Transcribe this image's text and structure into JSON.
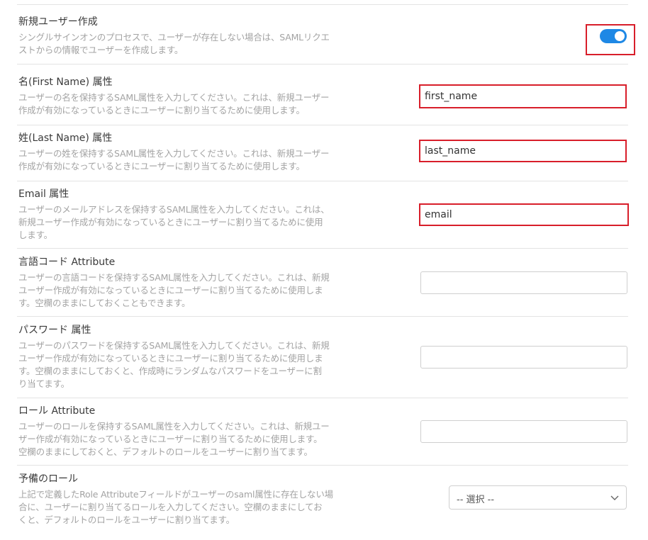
{
  "sections": {
    "create_user": {
      "label": "新規ユーザー作成",
      "desc": [
        "シングルサインオンのプロセスで、ユーザーが存在しない場合は、SAMLリクエ",
        "ストからの情報でユーザーを作成します。"
      ],
      "toggle_on": true
    },
    "first_name": {
      "label": "名(First Name) 属性",
      "desc": [
        "ユーザーの名を保持するSAML属性を入力してください。これは、新規ユーザー",
        "作成が有効になっているときにユーザーに割り当てるために使用します。"
      ],
      "value": "first_name"
    },
    "last_name": {
      "label": "姓(Last Name) 属性",
      "desc": [
        "ユーザーの姓を保持するSAML属性を入力してください。これは、新規ユーザー",
        "作成が有効になっているときにユーザーに割り当てるために使用します。"
      ],
      "value": "last_name"
    },
    "email": {
      "label": "Email 属性",
      "desc": [
        "ユーザーのメールアドレスを保持するSAML属性を入力してください。これは、",
        "新規ユーザー作成が有効になっているときにユーザーに割り当てるために使用",
        "します。"
      ],
      "value": "email"
    },
    "language": {
      "label": "言語コード Attribute",
      "desc": [
        "ユーザーの言語コードを保持するSAML属性を入力してください。これは、新規",
        "ユーザー作成が有効になっているときにユーザーに割り当てるために使用しま",
        "す。空欄のままにしておくこともできます。"
      ],
      "value": ""
    },
    "password": {
      "label": "パスワード 属性",
      "desc": [
        "ユーザーのパスワードを保持するSAML属性を入力してください。これは、新規",
        "ユーザー作成が有効になっているときにユーザーに割り当てるために使用しま",
        "す。空欄のままにしておくと、作成時にランダムなパスワードをユーザーに割",
        "り当てます。"
      ],
      "value": ""
    },
    "role": {
      "label": "ロール Attribute",
      "desc": [
        "ユーザーのロールを保持するSAML属性を入力してください。これは、新規ユー",
        "ザー作成が有効になっているときにユーザーに割り当てるために使用します。",
        "空欄のままにしておくと、デフォルトのロールをユーザーに割り当てます。"
      ],
      "value": ""
    },
    "fallback_role": {
      "label": "予備のロール",
      "desc": [
        "上記で定義したRole Attributeフィールドがユーザーのsaml属性に存在しない場",
        "合に、ユーザーに割り当てるロールを入力してください。空欄のままにしてお",
        "くと、デフォルトのロールをユーザーに割り当てます。"
      ],
      "select_value": "-- 選択 --"
    }
  },
  "colors": {
    "accent": "#1e88e5",
    "highlight": "#d81e2a"
  },
  "icons": {
    "select_arrow": "chevron-down-icon"
  }
}
